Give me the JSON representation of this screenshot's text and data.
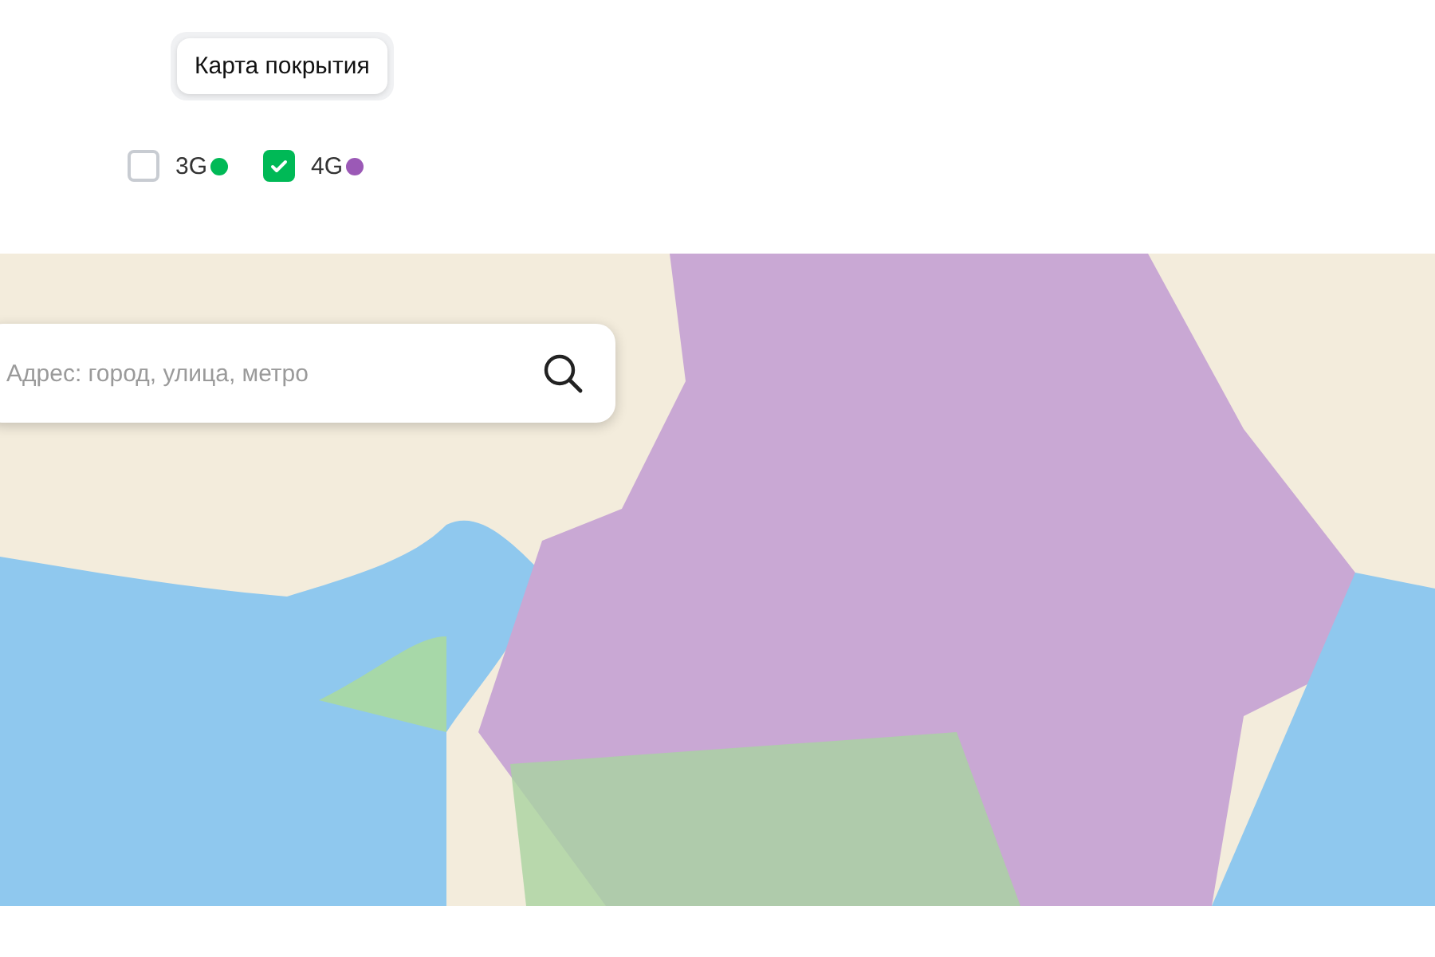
{
  "tabs": [
    {
      "label": "Карта покрытия",
      "selected": true
    }
  ],
  "filters": [
    {
      "label": "3G",
      "checked": false,
      "color": "#00b956"
    },
    {
      "label": "4G",
      "checked": true,
      "color": "#9b59b6"
    }
  ],
  "map": {
    "search": {
      "placeholder": "Адрес: город, улица, метро"
    }
  }
}
